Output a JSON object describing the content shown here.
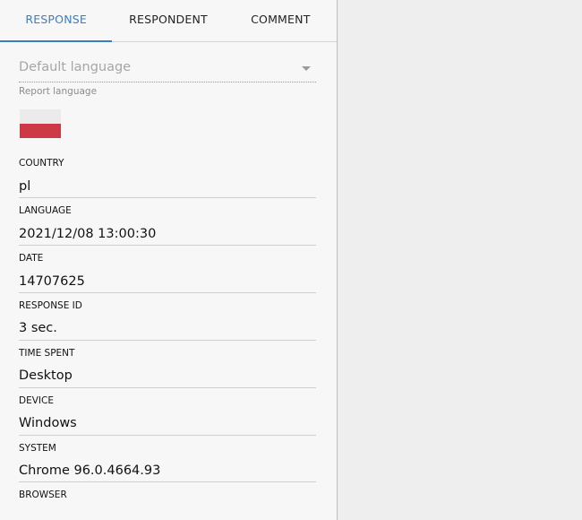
{
  "tabs": [
    {
      "label": "RESPONSE",
      "active": true
    },
    {
      "label": "RESPONDENT",
      "active": false
    },
    {
      "label": "COMMENT",
      "active": false
    }
  ],
  "report_language": {
    "selected": "Default language",
    "label": "Report language"
  },
  "flag": {
    "icon": "poland-flag-icon",
    "colors": {
      "top": "#ebebeb",
      "bottom": "#cd3a47"
    }
  },
  "fields": [
    {
      "label": "COUNTRY",
      "value": "pl"
    },
    {
      "label": "LANGUAGE",
      "value": "2021/12/08 13:00:30"
    },
    {
      "label": "DATE",
      "value": "14707625"
    },
    {
      "label": "RESPONSE ID",
      "value": "3 sec."
    },
    {
      "label": "TIME SPENT",
      "value": "Desktop"
    },
    {
      "label": "DEVICE",
      "value": "Windows"
    },
    {
      "label": "SYSTEM",
      "value": "Chrome 96.0.4664.93"
    },
    {
      "label": "BROWSER",
      "value": ""
    }
  ],
  "colors": {
    "accent": "#3a7ec0",
    "panel_bg": "#f7f7f7",
    "page_bg": "#eeeeee"
  }
}
